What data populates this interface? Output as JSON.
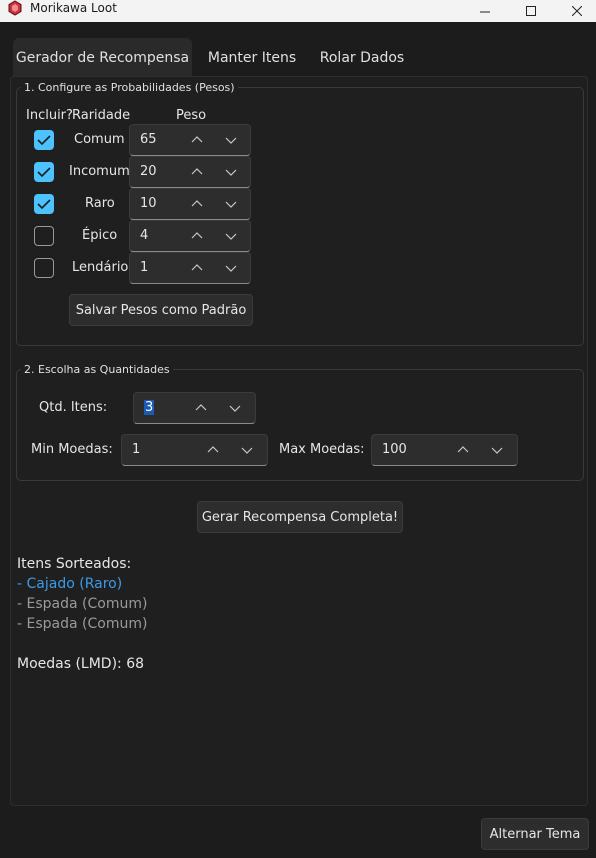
{
  "window": {
    "title": "Morikawa Loot"
  },
  "tabs": [
    {
      "label": "Gerador de Recompensa",
      "active": true
    },
    {
      "label": "Manter Itens",
      "active": false
    },
    {
      "label": "Rolar Dados",
      "active": false
    }
  ],
  "weights_group": {
    "title": "1. Configure as Probabilidades (Pesos)",
    "header_include": "Incluir?",
    "header_rarity": "Raridade",
    "header_weight": "Peso",
    "rows": [
      {
        "rarity": "Comum",
        "included": true,
        "weight": "65"
      },
      {
        "rarity": "Incomum",
        "included": true,
        "weight": "20"
      },
      {
        "rarity": "Raro",
        "included": true,
        "weight": "10"
      },
      {
        "rarity": "Épico",
        "included": false,
        "weight": "4"
      },
      {
        "rarity": "Lendário",
        "included": false,
        "weight": "1"
      }
    ],
    "save_button": "Salvar Pesos como Padrão"
  },
  "quantities_group": {
    "title": "2. Escolha as Quantidades",
    "items_label": "Qtd. Itens:",
    "items_value": "3",
    "min_coins_label": "Min Moedas:",
    "min_coins_value": "1",
    "max_coins_label": "Max Moedas:",
    "max_coins_value": "100"
  },
  "generate_button": "Gerar Recompensa Completa!",
  "results": {
    "heading": "Itens Sorteados:",
    "items": [
      {
        "text": "- Cajado (Raro)",
        "color": "#3d9ae8"
      },
      {
        "text": "- Espada (Comum)",
        "color": "#9a9a9a"
      },
      {
        "text": "- Espada (Comum)",
        "color": "#9a9a9a"
      }
    ],
    "coins": "Moedas (LMD): 68"
  },
  "theme_button": "Alternar Tema",
  "colors": {
    "accent": "#4cc2ff",
    "rare": "#3d9ae8",
    "common": "#9a9a9a"
  }
}
